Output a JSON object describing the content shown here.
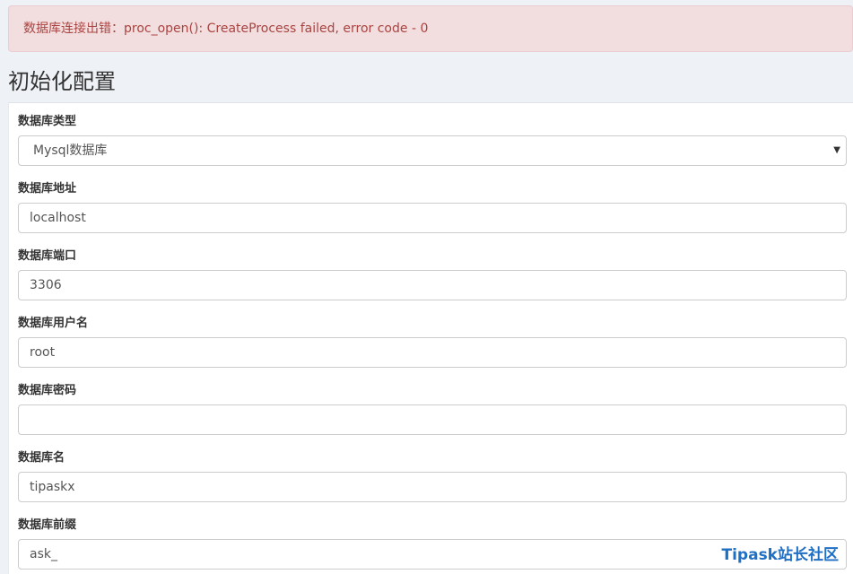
{
  "alert": {
    "message": "数据库连接出错：proc_open(): CreateProcess failed, error code - 0"
  },
  "page": {
    "title": "初始化配置"
  },
  "form": {
    "db_type": {
      "label": "数据库类型",
      "value": "Mysql数据库"
    },
    "db_host": {
      "label": "数据库地址",
      "value": "localhost"
    },
    "db_port": {
      "label": "数据库端口",
      "value": "3306"
    },
    "db_user": {
      "label": "数据库用户名",
      "value": "root"
    },
    "db_password": {
      "label": "数据库密码",
      "value": ""
    },
    "db_name": {
      "label": "数据库名",
      "value": "tipaskx"
    },
    "db_prefix": {
      "label": "数据库前缀",
      "value": "ask_"
    }
  },
  "watermark": {
    "text": "Tipask站长社区"
  },
  "colors": {
    "alert_bg": "#f2dede",
    "alert_text": "#a94442",
    "page_bg": "#eef1f5",
    "watermark": "#1f6fc5"
  },
  "icons": {
    "select_caret": "caret-down-icon"
  }
}
